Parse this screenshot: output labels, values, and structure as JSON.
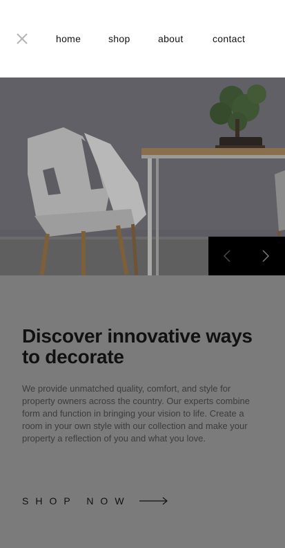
{
  "nav": {
    "close_icon": "close-icon",
    "links": [
      {
        "label": "home"
      },
      {
        "label": "shop"
      },
      {
        "label": "about"
      },
      {
        "label": "contact"
      }
    ]
  },
  "slider": {
    "prev_icon": "chevron-left-icon",
    "next_icon": "chevron-right-icon"
  },
  "content": {
    "headline": "Discover innovative ways to decorate",
    "body": "We provide unmatched quality, comfort, and style for property owners across the country. Our experts combine form and function in bringing your vision to life. Create a room in your own style with our collection and make your property a reflection of you and what you love.",
    "cta_label": "SHOP NOW",
    "cta_icon": "arrow-right-icon"
  },
  "colors": {
    "nav_bg": "#ffffff",
    "overlay": "#7b7b7b",
    "text_dark": "#111111",
    "slider_bg": "#000000"
  }
}
